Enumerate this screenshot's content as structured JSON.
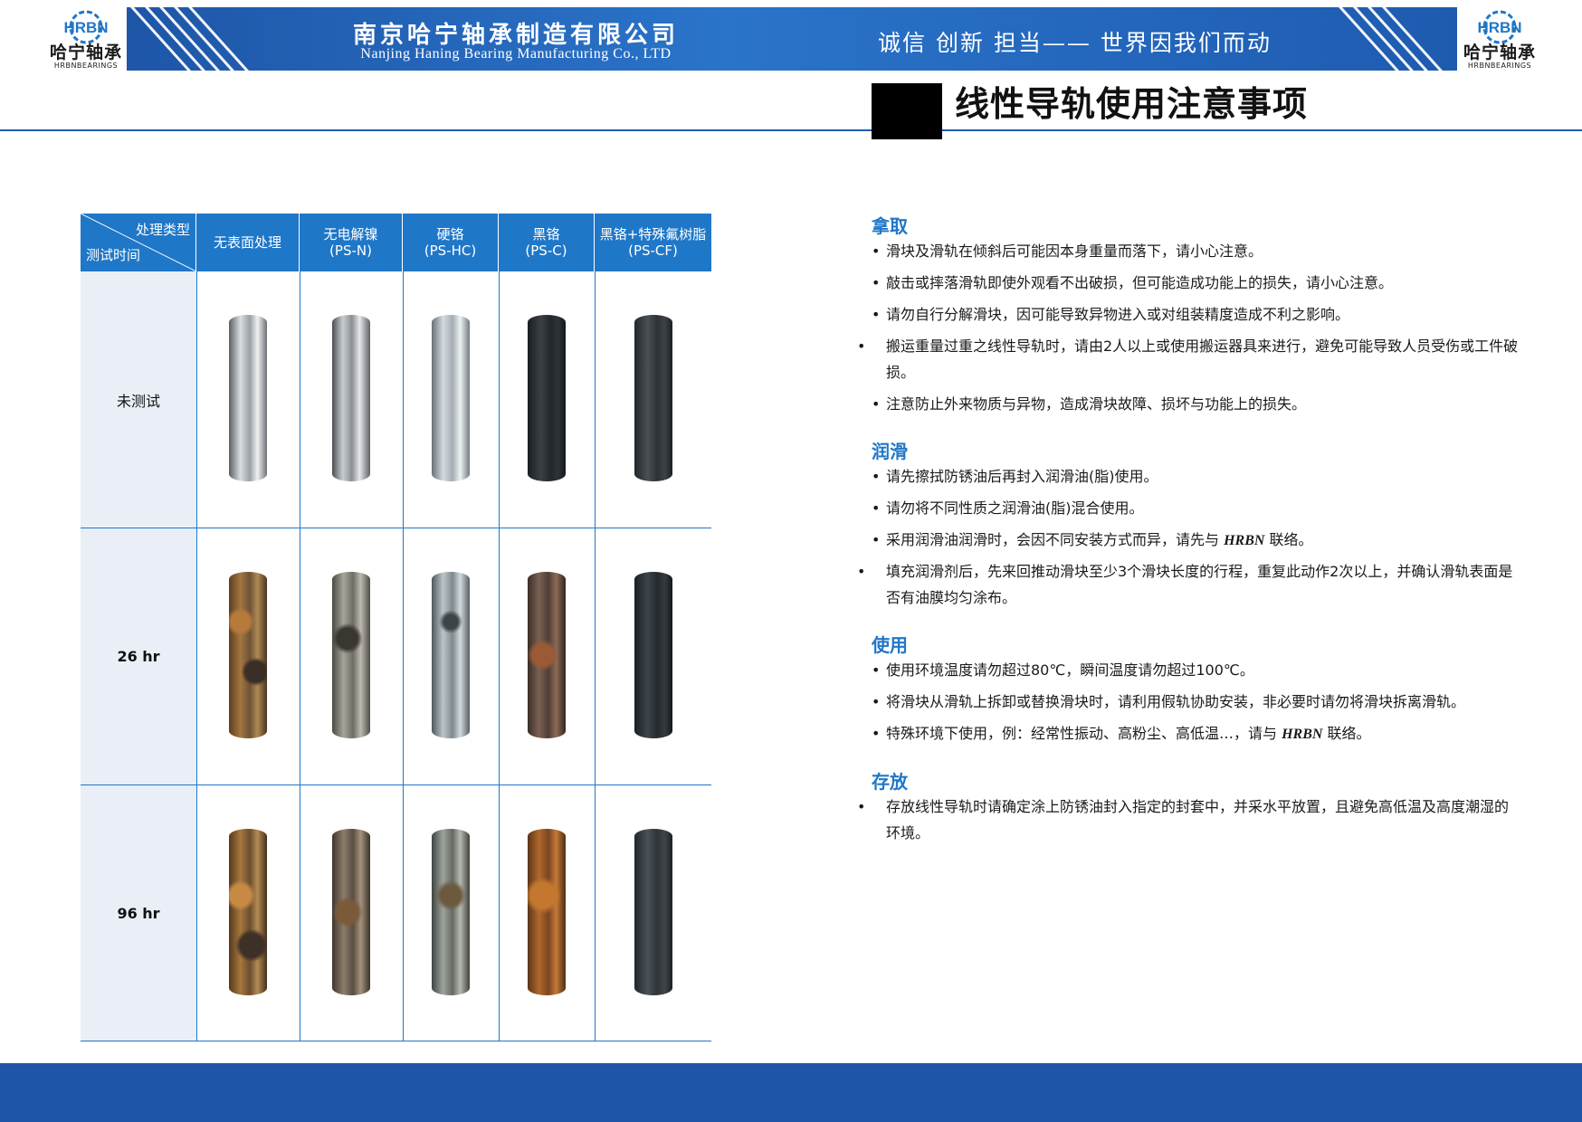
{
  "header": {
    "logo_text": "HRBN",
    "logo_cn": "哈宁轴承",
    "logo_en": "HRBNBEARINGS",
    "company_cn": "南京哈宁轴承制造有限公司",
    "company_en": "Nanjing Haning Bearing Manufacturing Co., LTD",
    "slogan": "诚信 创新 担当—— 世界因我们而动",
    "colors": {
      "banner": "#1e5bb0",
      "accent": "#1f77c8"
    }
  },
  "page_title": "线性导轨使用注意事项",
  "table": {
    "corner_top": "处理类型",
    "corner_bottom": "测试时间",
    "columns": [
      {
        "line1": "无表面处理",
        "line2": ""
      },
      {
        "line1": "无电解镍",
        "line2": "(PS-N)"
      },
      {
        "line1": "硬铬",
        "line2": "(PS-HC)"
      },
      {
        "line1": "黑铬",
        "line2": "(PS-C)"
      },
      {
        "line1": "黑铬+特殊氟树脂",
        "line2": "(PS-CF)"
      }
    ],
    "rows": [
      {
        "label": "未测试"
      },
      {
        "label": "26 hr"
      },
      {
        "label": "96 hr"
      }
    ]
  },
  "sections": [
    {
      "title": "拿取",
      "items": [
        "滑块及滑轨在倾斜后可能因本身重量而落下，请小心注意。",
        "敲击或摔落滑轨即使外观看不出破损，但可能造成功能上的损失，请小心注意。",
        "请勿自行分解滑块，因可能导致异物进入或对组装精度造成不利之影响。",
        "搬运重量过重之线性导轨时，请由2人以上或使用搬运器具来进行，避免可能导致人员受伤或工件破损。",
        "注意防止外来物质与异物，造成滑块故障、损坏与功能上的损失。"
      ]
    },
    {
      "title": "润滑",
      "items": [
        "请先擦拭防锈油后再封入润滑油(脂)使用。",
        "请勿将不同性质之润滑油(脂)混合使用。",
        "采用润滑油润滑时，会因不同安装方式而异，请先与",
        "填充润滑剂后，先来回推动滑块至少3个滑块长度的行程，重复此动作2次以上，并确认滑轨表面是否有油膜均匀涂布。"
      ],
      "brand": "HRBN",
      "tail": "联络。"
    },
    {
      "title": "使用",
      "items": [
        "使用环境温度请勿超过80℃，瞬间温度请勿超过100℃。",
        "将滑块从滑轨上拆卸或替换滑块时，请利用假轨协助安装，非必要时请勿将滑块拆离滑轨。",
        "特殊环境下使用，例：经常性振动、高粉尘、高低温…，请与"
      ],
      "brand": "HRBN",
      "tail": "联络。"
    },
    {
      "title": "存放",
      "items": [
        "存放线性导轨时请确定涂上防锈油封入指定的封套中，并采水平放置，且避免高低温及高度潮湿的环境。"
      ]
    }
  ],
  "bullet": "•"
}
